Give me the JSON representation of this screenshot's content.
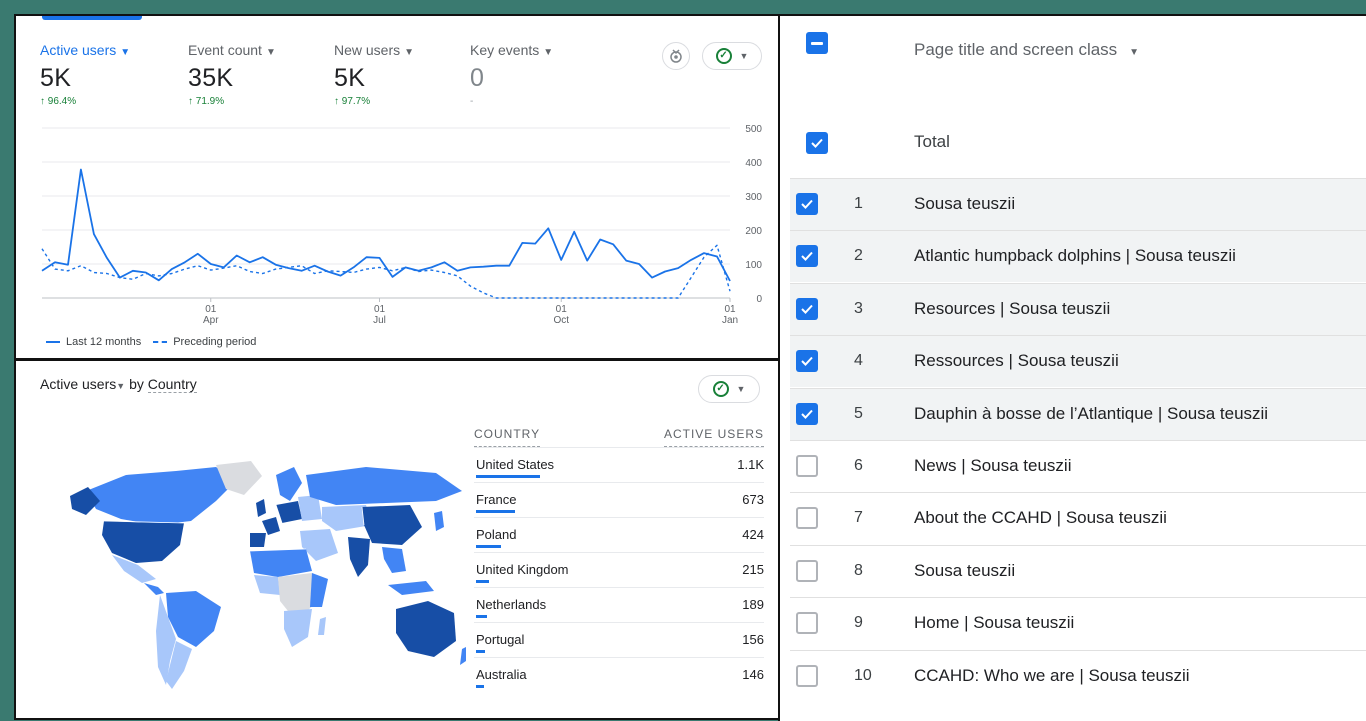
{
  "metrics": [
    {
      "label": "Active users",
      "value": "5K",
      "delta": "↑ 96.4%",
      "active": true
    },
    {
      "label": "Event count",
      "value": "35K",
      "delta": "↑ 71.9%",
      "active": false
    },
    {
      "label": "New users",
      "value": "5K",
      "delta": "↑ 97.7%",
      "active": false
    },
    {
      "label": "Key events",
      "value": "0",
      "delta": "-",
      "active": false
    }
  ],
  "chart_data": {
    "type": "line",
    "y_ticks": [
      "500",
      "400",
      "300",
      "200",
      "100",
      "0"
    ],
    "ylim": [
      0,
      500
    ],
    "x_ticks": [
      {
        "day": "01",
        "month": "Apr",
        "index": 13
      },
      {
        "day": "01",
        "month": "Jul",
        "index": 26
      },
      {
        "day": "01",
        "month": "Oct",
        "index": 40
      },
      {
        "day": "01",
        "month": "Jan",
        "index": 53
      }
    ],
    "series": [
      {
        "name": "Last 12 months",
        "style": "solid",
        "values": [
          80,
          105,
          98,
          378,
          188,
          118,
          60,
          80,
          75,
          52,
          85,
          105,
          130,
          100,
          90,
          125,
          105,
          120,
          98,
          88,
          80,
          95,
          78,
          66,
          90,
          120,
          118,
          62,
          90,
          80,
          90,
          105,
          80,
          90,
          92,
          95,
          95,
          162,
          160,
          205,
          112,
          195,
          110,
          172,
          158,
          110,
          100,
          60,
          78,
          88,
          112,
          132,
          122,
          50
        ]
      },
      {
        "name": "Preceding period",
        "style": "dashed",
        "values": [
          145,
          85,
          80,
          95,
          75,
          72,
          60,
          55,
          72,
          65,
          72,
          85,
          95,
          82,
          88,
          95,
          78,
          72,
          85,
          90,
          95,
          72,
          80,
          78,
          75,
          85,
          90,
          80,
          90,
          78,
          82,
          75,
          65,
          35,
          15,
          0,
          0,
          0,
          0,
          0,
          0,
          0,
          0,
          0,
          0,
          0,
          0,
          0,
          0,
          0,
          60,
          120,
          155,
          20
        ]
      }
    ]
  },
  "map_section": {
    "title_metric": "Active users",
    "title_by": "by",
    "title_dim": "Country",
    "col_country": "COUNTRY",
    "col_users": "ACTIVE USERS",
    "rows": [
      {
        "country": "United States",
        "users": "1.1K",
        "value": 1100
      },
      {
        "country": "France",
        "users": "673",
        "value": 673
      },
      {
        "country": "Poland",
        "users": "424",
        "value": 424
      },
      {
        "country": "United Kingdom",
        "users": "215",
        "value": 215
      },
      {
        "country": "Netherlands",
        "users": "189",
        "value": 189
      },
      {
        "country": "Portugal",
        "users": "156",
        "value": 156
      },
      {
        "country": "Australia",
        "users": "146",
        "value": 146
      }
    ]
  },
  "table": {
    "column_header": "Page title and screen class",
    "total_label": "Total",
    "rows": [
      {
        "n": "1",
        "title": "Sousa teuszii",
        "checked": true
      },
      {
        "n": "2",
        "title": "Atlantic humpback dolphins | Sousa teuszii",
        "checked": true
      },
      {
        "n": "3",
        "title": "Resources | Sousa teuszii",
        "checked": true
      },
      {
        "n": "4",
        "title": "Ressources | Sousa teuszii",
        "checked": true
      },
      {
        "n": "5",
        "title": "Dauphin à bosse de l’Atlantique | Sousa teuszii",
        "checked": true
      },
      {
        "n": "6",
        "title": "News | Sousa teuszii",
        "checked": false
      },
      {
        "n": "7",
        "title": "About the CCAHD | Sousa teuszii",
        "checked": false
      },
      {
        "n": "8",
        "title": "Sousa teuszii",
        "checked": false
      },
      {
        "n": "9",
        "title": "Home | Sousa teuszii",
        "checked": false
      },
      {
        "n": "10",
        "title": "CCAHD: Who we are | Sousa teuszii",
        "checked": false
      }
    ]
  },
  "colors": {
    "accent": "#1a73e8",
    "positive": "#188038",
    "map_dark": "#174ea6",
    "map_mid": "#4285f4",
    "map_light": "#a8c7fa",
    "map_none": "#dadce0"
  }
}
